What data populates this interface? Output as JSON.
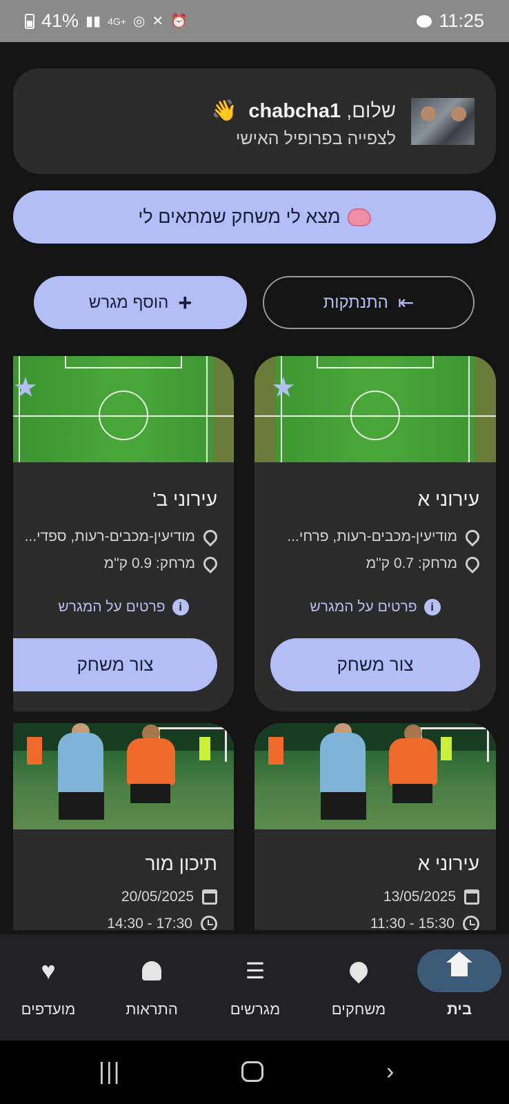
{
  "status_bar": {
    "battery": "41%",
    "network": "4G+",
    "time": "11:25"
  },
  "profile": {
    "greeting": "שלום,",
    "username": "chabcha1",
    "wave_emoji": "👋",
    "subtitle": "לצפייה בפרופיל האישי"
  },
  "match_button": {
    "label": "מצא לי משחק שמתאים לי"
  },
  "actions": {
    "logout_label": "התנתקות",
    "add_field_label": "הוסף מגרש"
  },
  "field_cards": [
    {
      "name": "עירוני א",
      "location": "מודיעין-מכבים-רעות, פרחי...",
      "distance": "מרחק: 0.7 ק\"מ",
      "details_label": "פרטים על המגרש",
      "create_label": "צור משחק"
    },
    {
      "name": "עירוני ב'",
      "location": "מודיעין-מכבים-רעות, ספדי...",
      "distance": "מרחק: 0.9 ק\"מ",
      "details_label": "פרטים על המגרש",
      "create_label": "צור משחק"
    }
  ],
  "game_cards": [
    {
      "name": "עירוני א",
      "date": "13/05/2025",
      "time": "15:30 - 11:30"
    },
    {
      "name": "תיכון מור",
      "date": "20/05/2025",
      "time": "17:30 - 14:30"
    }
  ],
  "bottom_nav": {
    "items": [
      {
        "label": "בית",
        "icon": "home-icon",
        "active": true
      },
      {
        "label": "משחקים",
        "icon": "location-pin-icon",
        "active": false
      },
      {
        "label": "מגרשים",
        "icon": "list-icon",
        "active": false
      },
      {
        "label": "התראות",
        "icon": "bell-icon",
        "active": false
      },
      {
        "label": "מועדפים",
        "icon": "heart-icon",
        "active": false
      }
    ]
  },
  "colors": {
    "accent": "#b3bdf6",
    "background": "#141414",
    "card": "#2b2b2b",
    "nav_active": "#3d5a78"
  }
}
